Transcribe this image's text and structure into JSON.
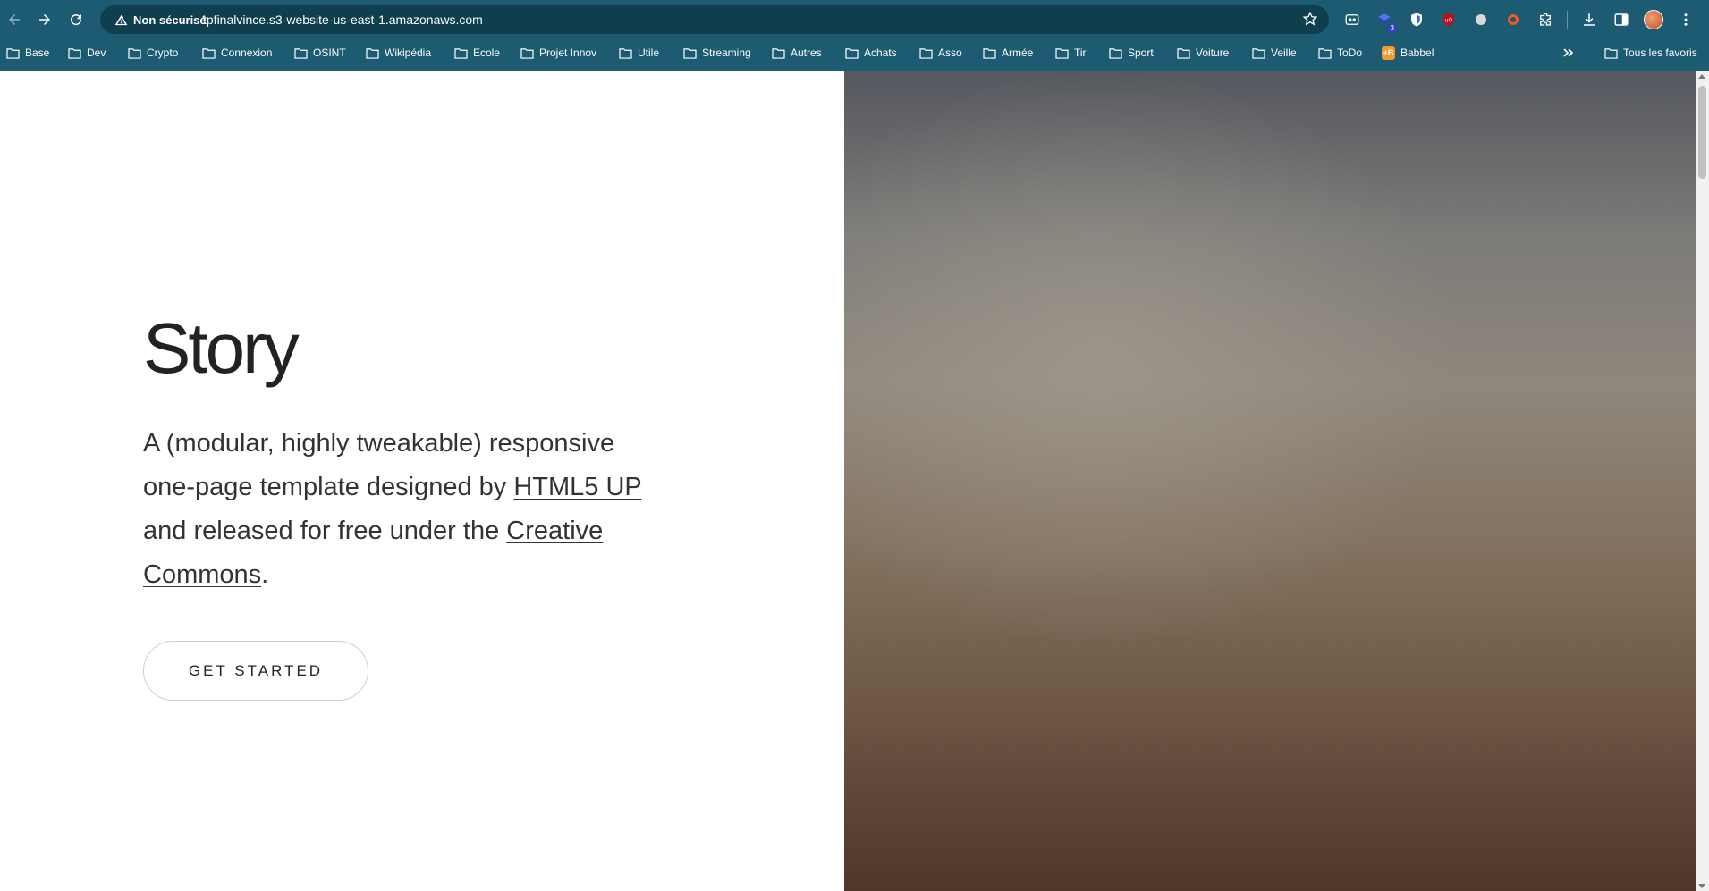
{
  "browser": {
    "security_label": "Non sécurisé",
    "url": "tpfinalvince.s3-website-us-east-1.amazonaws.com",
    "extension_badge": "3",
    "icons": [
      "back-icon",
      "forward-icon",
      "reload-icon",
      "warning-icon",
      "star-icon",
      "extension-icon",
      "download-icon",
      "side-panel-icon",
      "menu-icon"
    ]
  },
  "bookmarks": {
    "items": [
      {
        "label": "Base"
      },
      {
        "label": "Dev"
      },
      {
        "label": "Crypto"
      },
      {
        "label": "Connexion"
      },
      {
        "label": "OSINT"
      },
      {
        "label": "Wikipédia"
      },
      {
        "label": "Ecole"
      },
      {
        "label": "Projet Innov"
      },
      {
        "label": "Utile"
      },
      {
        "label": "Streaming"
      },
      {
        "label": "Autres"
      },
      {
        "label": "Achats"
      },
      {
        "label": "Asso"
      },
      {
        "label": "Armée"
      },
      {
        "label": "Tir"
      },
      {
        "label": "Sport"
      },
      {
        "label": "Voiture"
      },
      {
        "label": "Veille"
      },
      {
        "label": "ToDo"
      },
      {
        "label": "Babbel"
      }
    ],
    "all_bookmarks_label": "Tous les favoris"
  },
  "page": {
    "title": "Story",
    "lead_text_1": "A (modular, highly tweakable) responsive one-page template designed by ",
    "lead_link_1": "HTML5 UP",
    "lead_text_2": " and released for free under the ",
    "lead_link_2": "Creative Commons",
    "lead_text_3": ".",
    "cta_label": "GET STARTED"
  },
  "colors": {
    "chrome_bg": "#1c5b72",
    "omnibox_bg": "#0f3e4f",
    "page_bg": "#ffffff",
    "text": "#222222"
  }
}
